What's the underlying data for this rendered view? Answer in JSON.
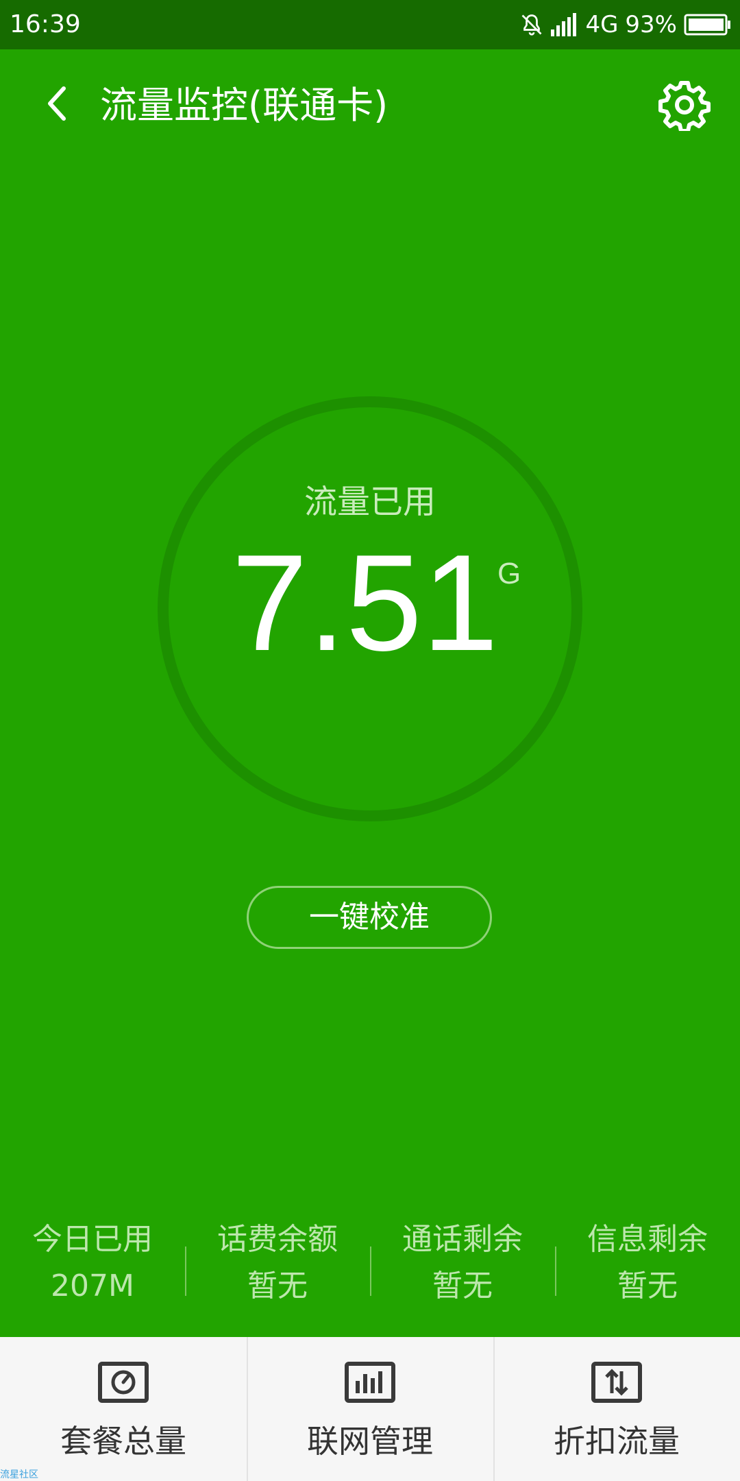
{
  "status_bar": {
    "time": "16:39",
    "network": "4G",
    "battery": "93%"
  },
  "header": {
    "title": "流量监控(联通卡)"
  },
  "gauge": {
    "label": "流量已用",
    "value": "7.51",
    "unit": "G"
  },
  "calibrate_label": "一键校准",
  "stats": [
    {
      "label": "今日已用",
      "value": "207M"
    },
    {
      "label": "话费余额",
      "value": "暂无"
    },
    {
      "label": "通话剩余",
      "value": "暂无"
    },
    {
      "label": "信息剩余",
      "value": "暂无"
    }
  ],
  "bottom_nav": [
    {
      "label": "套餐总量",
      "icon": "gauge-icon"
    },
    {
      "label": "联网管理",
      "icon": "bar-chart-icon"
    },
    {
      "label": "折扣流量",
      "icon": "transfer-icon"
    }
  ],
  "watermark": "流星社区",
  "colors": {
    "primary": "#22a400",
    "status_bar": "#166b00"
  }
}
